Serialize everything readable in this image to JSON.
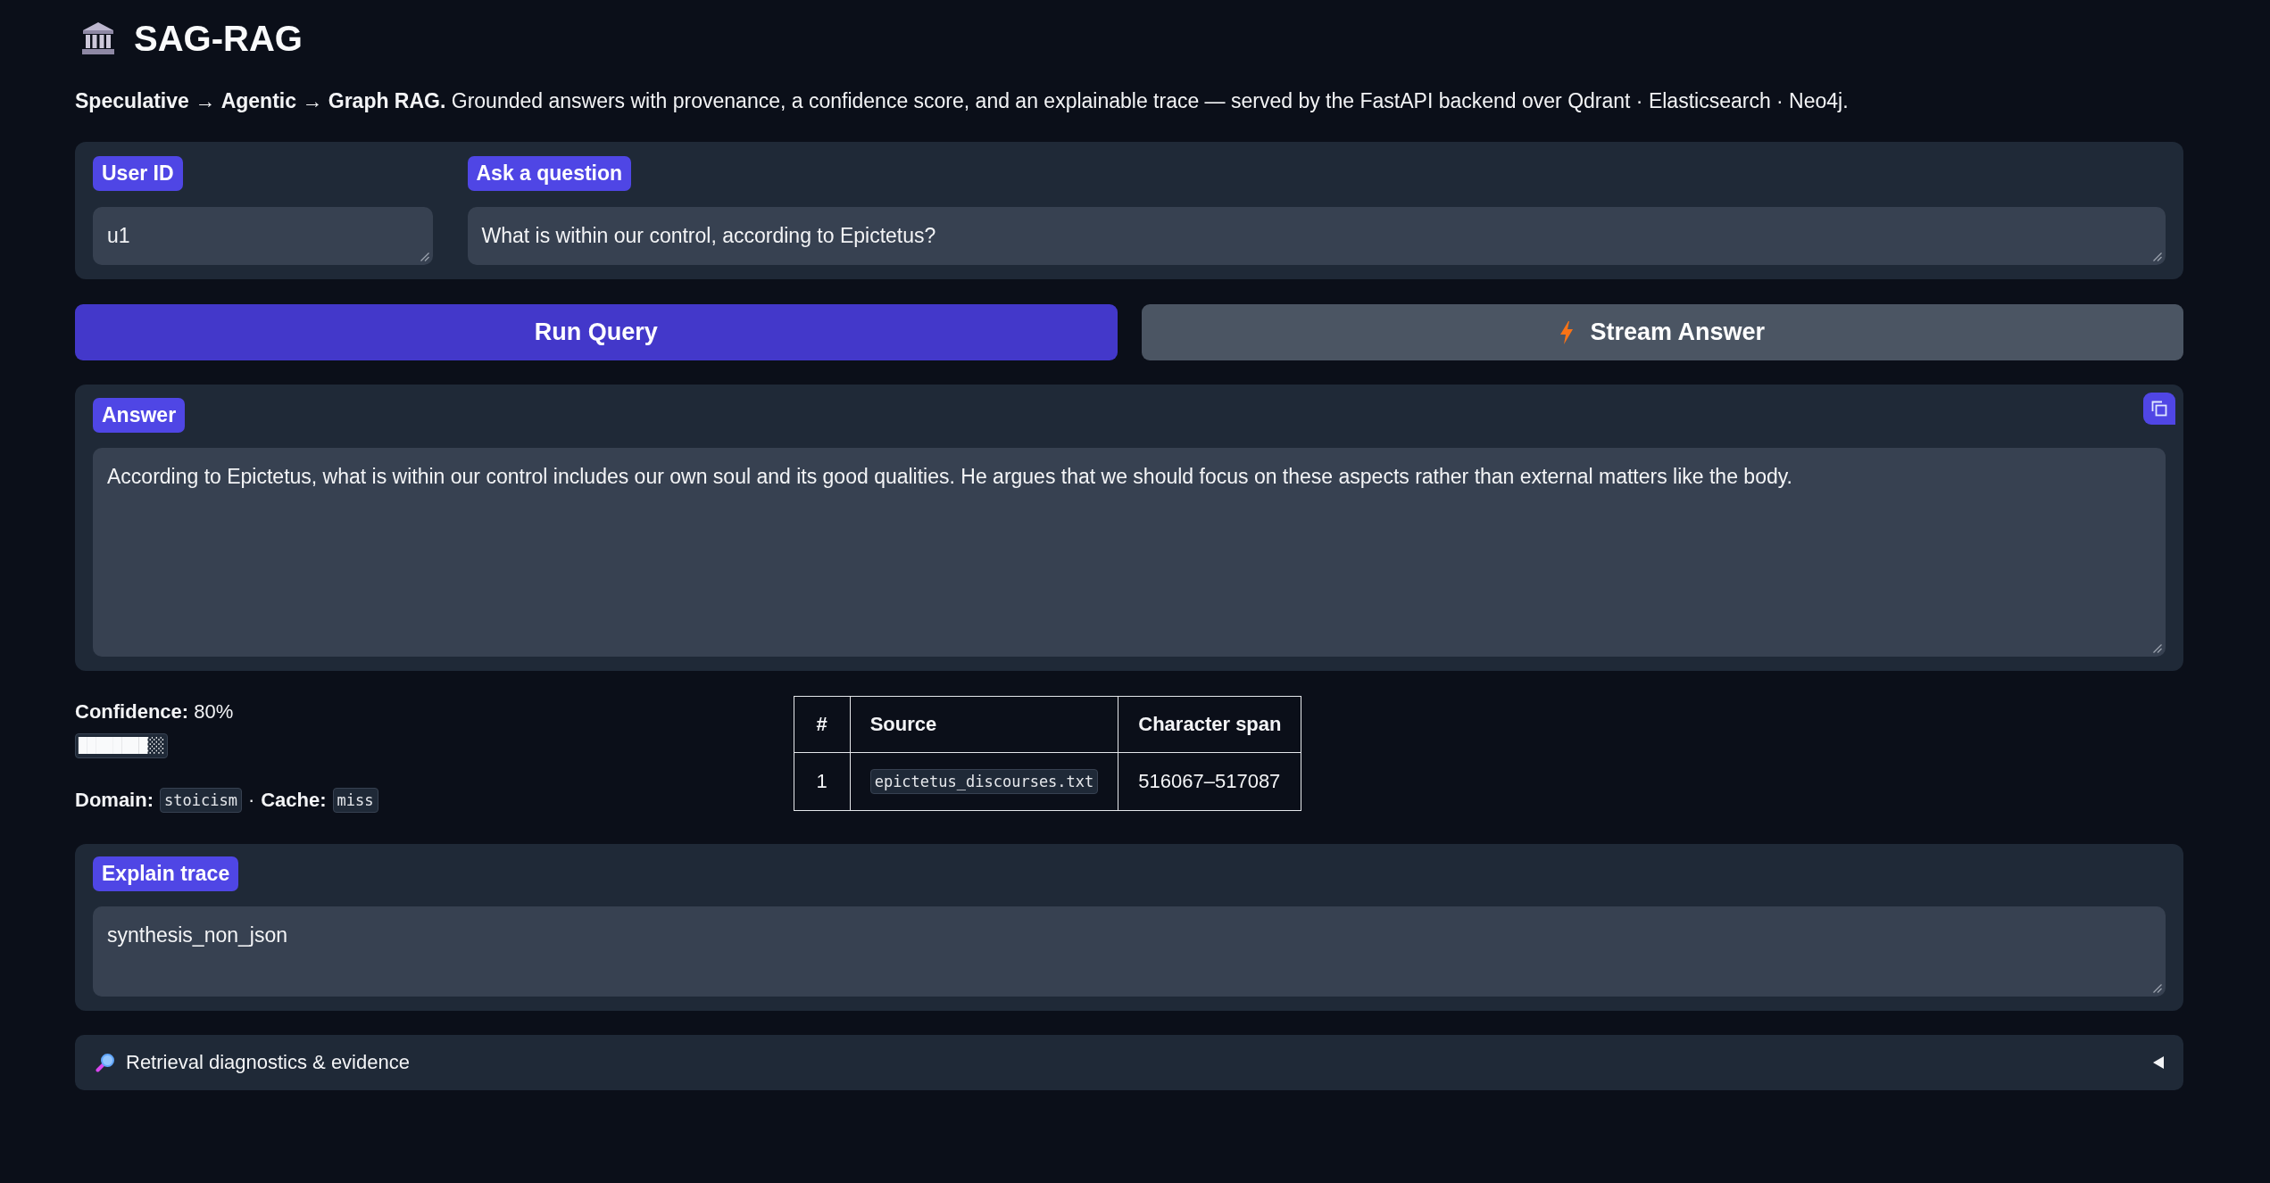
{
  "header": {
    "title": "SAG-RAG",
    "subtitle": "**Speculative** → **Agentic** → **Graph RAG.** Grounded answers with provenance, a confidence score, and an explainable trace — served by the FastAPI backend over Qdrant · Elasticsearch · Neo4j."
  },
  "query_form": {
    "user_id": {
      "label": "User ID",
      "value": "u1"
    },
    "question": {
      "label": "Ask a question",
      "value": "What is within our control, according to Epictetus?"
    }
  },
  "actions": [
    {
      "label": "Run Query",
      "kind": "primary"
    },
    {
      "label": "Stream Answer",
      "kind": "stream"
    }
  ],
  "answer": {
    "label": "Answer",
    "value": "According to Epictetus, what is within our control includes our own soul and its good qualities. He argues that we should focus on these aspects rather than external matters like the body."
  },
  "confidence": {
    "text": "**Confidence:** 80%",
    "bar": "████████░░"
  },
  "meta": {
    "items": [
      {
        "label": "Domain:",
        "value": "stoicism"
      },
      {
        "label": "Cache:",
        "value": "miss"
      }
    ],
    "separator": "·"
  },
  "sources": {
    "columns": [
      "#",
      "Source",
      "Character span"
    ],
    "rows": [
      [
        "1",
        "epictetus_discourses.txt",
        "516067–517087"
      ]
    ]
  },
  "explain_trace": {
    "label": "Explain trace",
    "value": "synthesis_non_json"
  },
  "diagnostics": {
    "title": "Retrieval diagnostics & evidence",
    "expanded": false
  }
}
